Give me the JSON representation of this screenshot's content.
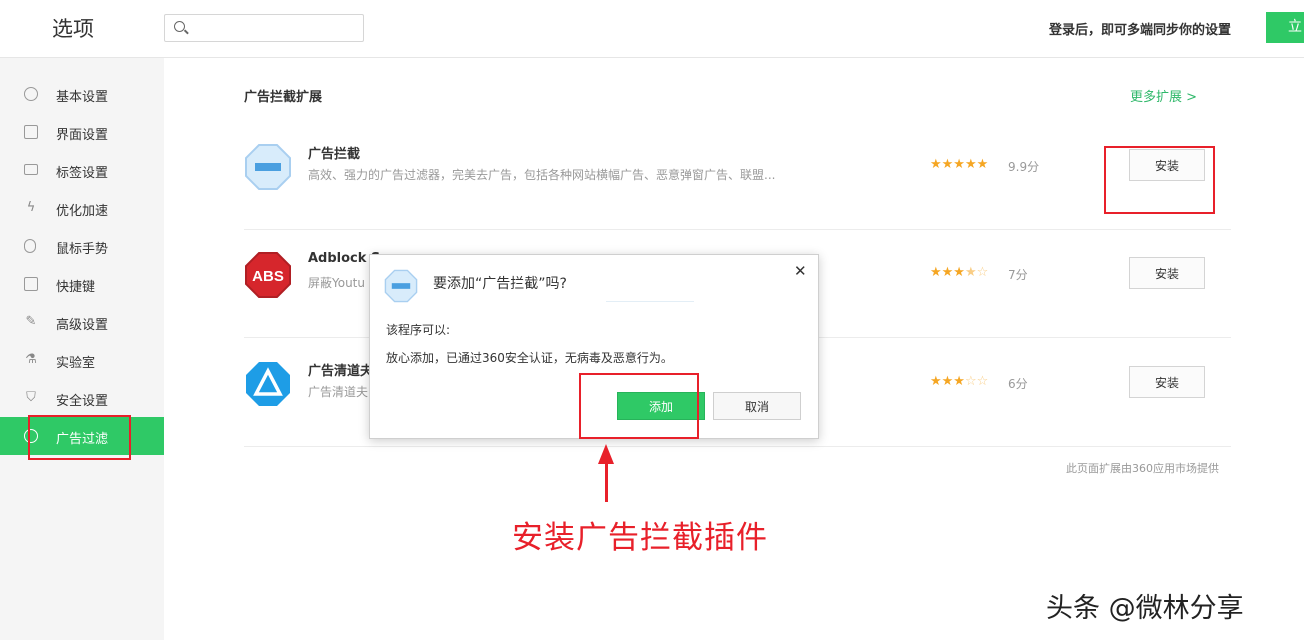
{
  "header": {
    "title": "选项",
    "search_placeholder": "",
    "login_tip": "登录后，即可多端同步你的设置",
    "login_button": "立"
  },
  "sidebar": {
    "items": [
      {
        "label": "基本设置",
        "icon": "gear-icon"
      },
      {
        "label": "界面设置",
        "icon": "window-icon"
      },
      {
        "label": "标签设置",
        "icon": "tab-icon"
      },
      {
        "label": "优化加速",
        "icon": "lightning-icon"
      },
      {
        "label": "鼠标手势",
        "icon": "mouse-icon"
      },
      {
        "label": "快捷键",
        "icon": "keyboard-icon"
      },
      {
        "label": "高级设置",
        "icon": "wrench-icon"
      },
      {
        "label": "实验室",
        "icon": "flask-icon"
      },
      {
        "label": "安全设置",
        "icon": "shield-icon"
      },
      {
        "label": "广告过滤",
        "icon": "block-icon",
        "active": true
      }
    ]
  },
  "main": {
    "section_title": "广告拦截扩展",
    "more_link": "更多扩展 >",
    "extensions": [
      {
        "name": "广告拦截",
        "desc": "高效、强力的广告过滤器，完美去广告，包括各种网站横幅广告、恶意弹窗广告、联盟...",
        "rating": 5,
        "score": "9.9分",
        "button": "安装"
      },
      {
        "name": "Adblock S",
        "desc": "屏蔽Youtu",
        "rating": 3.5,
        "score": "7分",
        "button": "安装"
      },
      {
        "name": "广告清道夫",
        "desc": "广告清道夫",
        "rating": 3,
        "score": "6分",
        "button": "安装"
      }
    ],
    "footnote": "此页面扩展由360应用市场提供"
  },
  "dialog": {
    "title": "要添加“广告拦截”吗?",
    "subtitle": "该程序可以:",
    "message": "放心添加，已通过360安全认证，无病毒及恶意行为。",
    "add_button": "添加",
    "cancel_button": "取消",
    "close": "✕"
  },
  "annotation": {
    "text": "安装广告拦截插件",
    "color": "#e8202a"
  },
  "watermark": "头条 @微林分享",
  "colors": {
    "accent": "#2fc966",
    "link": "#2fb86a",
    "star": "#f5a623"
  }
}
